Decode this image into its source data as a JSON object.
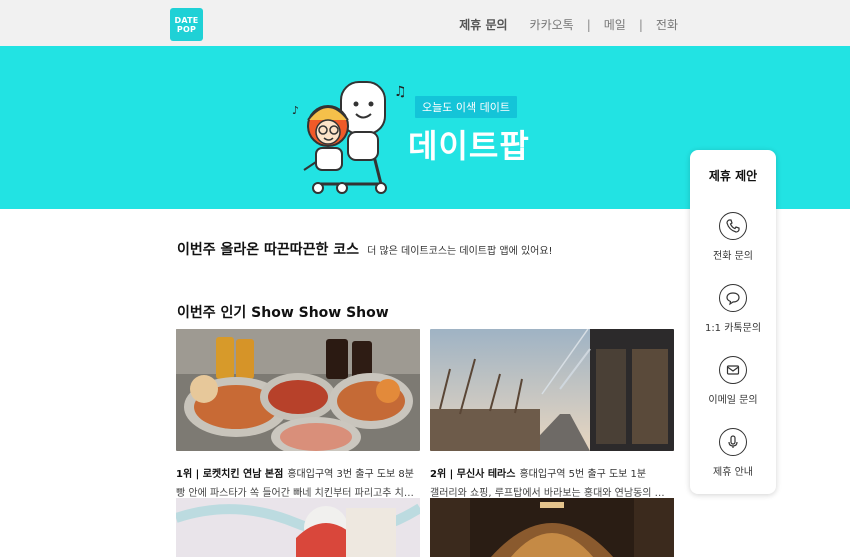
{
  "header": {
    "logo_line1": "DATE",
    "logo_line2": "POP",
    "nav": [
      "제휴 문의",
      "카카오톡",
      "메일",
      "전화"
    ],
    "separator": "|"
  },
  "banner": {
    "tag": "오늘도 이색 데이트",
    "brand": "데이트팝"
  },
  "section1": {
    "title": "이번주 올라온 따끈따끈한 코스",
    "sub": "더 많은 데이트코스는 데이트팝 앱에 있어요!"
  },
  "section2": {
    "title": "이번주 인기 Show Show Show"
  },
  "cards": [
    {
      "rank": "1위 | 로켓치킨 연남 본점",
      "location": "홍대입구역 3번 출구 도보 8분",
      "desc": "빵 안에 파스타가 쏙 들어간 빠네 치킨부터 파리고추 치킨..."
    },
    {
      "rank": "2위 | 무신사 테라스",
      "location": "홍대입구역 5번 출구 도보 1분",
      "desc": "갤러리와 쇼핑, 루프탑에서 바라보는 홍대와 연남동의 아..."
    }
  ],
  "panel": {
    "title": "제휴 제안",
    "items": [
      {
        "label": "전화 문의",
        "icon": "phone-icon"
      },
      {
        "label": "1:1 카톡문의",
        "icon": "chat-icon"
      },
      {
        "label": "이메일 문의",
        "icon": "email-icon"
      },
      {
        "label": "제휴 안내",
        "icon": "mic-icon"
      }
    ]
  },
  "colors": {
    "brand": "#22e3e3",
    "logo": "#1fd1d6",
    "tag": "#14c4d8"
  }
}
